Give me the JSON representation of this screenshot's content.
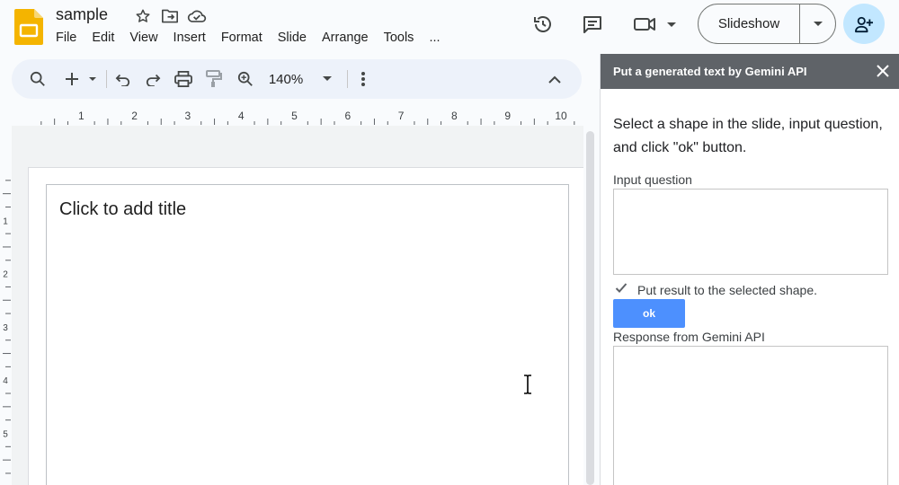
{
  "document": {
    "title": "sample"
  },
  "menu": {
    "items": [
      "File",
      "Edit",
      "View",
      "Insert",
      "Format",
      "Slide",
      "Arrange",
      "Tools",
      "..."
    ]
  },
  "header": {
    "slideshow_label": "Slideshow",
    "icons": [
      "star-icon",
      "move-to-folder-icon",
      "cloud-saved-icon",
      "history-icon",
      "comment-icon",
      "meet-camera-icon",
      "share-add-person-icon"
    ]
  },
  "toolbar": {
    "zoom": "140%",
    "icons": [
      "search-icon",
      "add-icon",
      "undo-icon",
      "redo-icon",
      "print-icon",
      "paint-format-icon",
      "zoom-icon",
      "more-vert-icon",
      "collapse-icon"
    ]
  },
  "ruler": {
    "labels": [
      "1",
      "2",
      "3",
      "4",
      "5",
      "6",
      "7",
      "8",
      "9",
      "10"
    ],
    "vertical_labels": [
      "1",
      "2",
      "3",
      "4",
      "5"
    ]
  },
  "slide": {
    "title_placeholder": "Click to add title"
  },
  "sidebar": {
    "title": "Put a generated text by Gemini API",
    "instruction": "Select a shape in the slide, input question, and click \"ok\" button.",
    "input_label": "Input question",
    "input_value": "",
    "checkbox_label": "Put result to the selected shape.",
    "checkbox_checked": true,
    "ok_label": "ok",
    "response_label": "Response from Gemini API",
    "response_value": ""
  },
  "colors": {
    "accent_button": "#4d90fe",
    "sidebar_header": "#5f6368",
    "share_button": "#c2e7ff",
    "slides_logo": "#f4b400"
  }
}
